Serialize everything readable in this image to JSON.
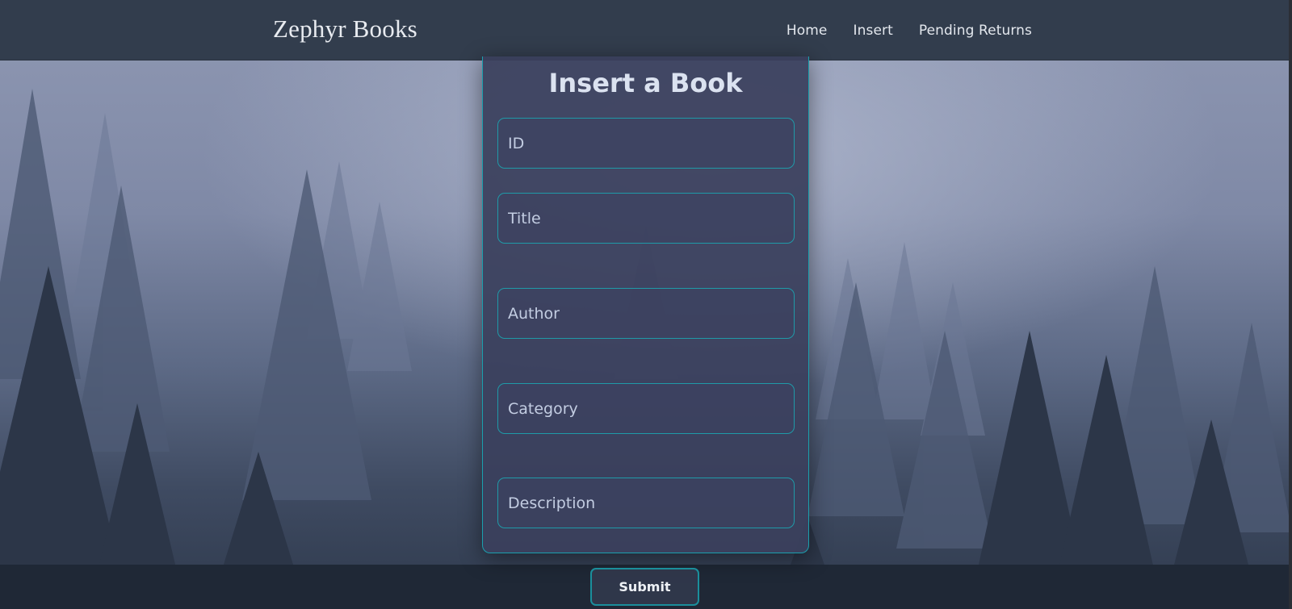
{
  "navbar": {
    "brand": "Zephyr Books",
    "links": [
      "Home",
      "Insert",
      "Pending Returns"
    ]
  },
  "form": {
    "title": "Insert a Book",
    "fields": [
      {
        "placeholder": "ID"
      },
      {
        "placeholder": "Title"
      },
      {
        "placeholder": "Author"
      },
      {
        "placeholder": "Category"
      },
      {
        "placeholder": "Description"
      }
    ],
    "submit_label": "Submit"
  },
  "background": {
    "description": "misty pine forest"
  },
  "colors": {
    "accent": "#1f9aa8",
    "navbar": "#323d4d",
    "card": "#3a405c"
  }
}
